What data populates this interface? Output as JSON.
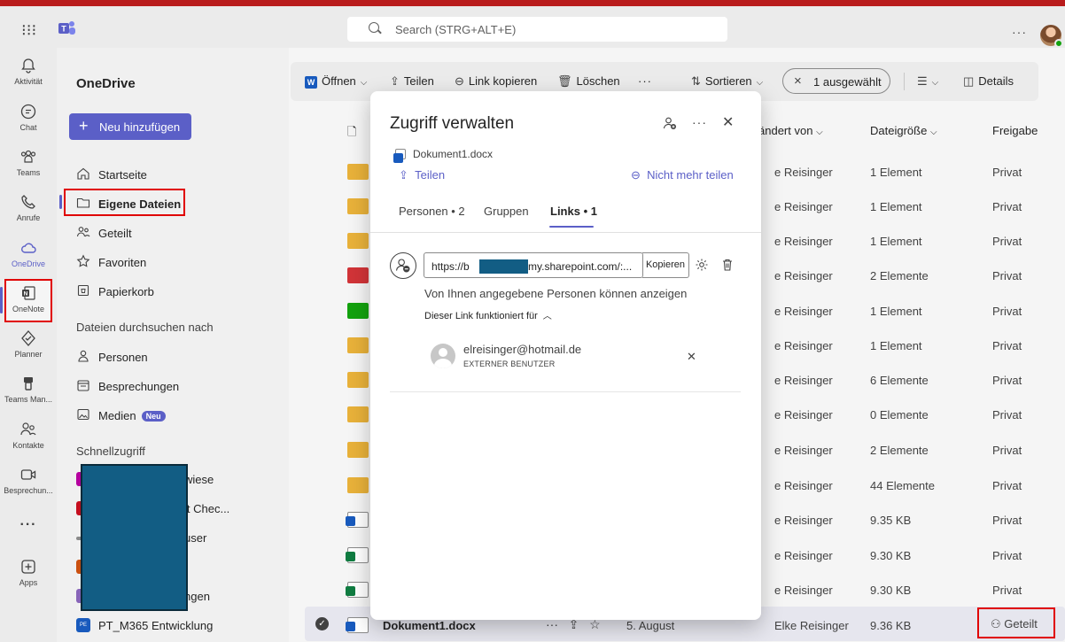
{
  "topbar": {
    "search_placeholder": "Search (STRG+ALT+E)",
    "more": "···"
  },
  "rail": {
    "items": [
      {
        "label": "Aktivität",
        "icon": "bell-icon"
      },
      {
        "label": "Chat",
        "icon": "chat-icon"
      },
      {
        "label": "Teams",
        "icon": "teams-icon"
      },
      {
        "label": "Anrufe",
        "icon": "phone-icon"
      },
      {
        "label": "OneDrive",
        "icon": "cloud-icon"
      },
      {
        "label": "OneNote",
        "icon": "onenote-icon"
      },
      {
        "label": "Planner",
        "icon": "planner-icon"
      },
      {
        "label": "Teams Man...",
        "icon": "teams-manager-icon"
      },
      {
        "label": "Kontakte",
        "icon": "contacts-icon"
      },
      {
        "label": "Besprechun...",
        "icon": "video-icon"
      },
      {
        "label": "···",
        "icon": "more-icon"
      },
      {
        "label": "Apps",
        "icon": "apps-icon"
      }
    ]
  },
  "sidebar": {
    "title": "OneDrive",
    "new_button": "Neu hinzufügen",
    "nav": [
      {
        "label": "Startseite"
      },
      {
        "label": "Eigene Dateien"
      },
      {
        "label": "Geteilt"
      },
      {
        "label": "Favoriten"
      },
      {
        "label": "Papierkorb"
      }
    ],
    "browse_header": "Dateien durchsuchen nach",
    "browse": [
      {
        "label": "Personen"
      },
      {
        "label": "Besprechungen"
      },
      {
        "label": "Medien",
        "badge": "Neu"
      }
    ],
    "quick_header": "Schnellzugriff",
    "quick": [
      {
        "label": "wiese",
        "color": "#b4009e"
      },
      {
        "label": "lt Chec...",
        "color": "#c50f1f"
      },
      {
        "label": "user",
        "color": "#8a8a8a"
      },
      {
        "label": "",
        "color": "#ca5010"
      },
      {
        "label": "ngen",
        "color": "#8764b8"
      },
      {
        "label": "PT_M365 Entwicklung",
        "color": "#185abd",
        "abbr": "PE"
      }
    ]
  },
  "toolbar": {
    "open": "Öffnen",
    "share": "Teilen",
    "copy_link": "Link kopieren",
    "delete": "Löschen",
    "more": "···",
    "sort": "Sortieren",
    "selected": "1 ausgewählt",
    "details": "Details"
  },
  "table": {
    "col_modified_by": "ändert von",
    "col_size": "Dateigröße",
    "col_share": "Freigabe",
    "rows": [
      {
        "type": "folder",
        "by": "e Reisinger",
        "size": "1 Element",
        "share": "Privat"
      },
      {
        "type": "folder",
        "by": "e Reisinger",
        "size": "1 Element",
        "share": "Privat"
      },
      {
        "type": "folder",
        "by": "e Reisinger",
        "size": "1 Element",
        "share": "Privat"
      },
      {
        "type": "folder-red",
        "by": "e Reisinger",
        "size": "2 Elemente",
        "share": "Privat"
      },
      {
        "type": "folder-green",
        "by": "e Reisinger",
        "size": "1 Element",
        "share": "Privat"
      },
      {
        "type": "folder",
        "by": "e Reisinger",
        "size": "1 Element",
        "share": "Privat"
      },
      {
        "type": "folder",
        "by": "e Reisinger",
        "size": "6 Elemente",
        "share": "Privat"
      },
      {
        "type": "folder",
        "by": "e Reisinger",
        "size": "0 Elemente",
        "share": "Privat"
      },
      {
        "type": "folder",
        "by": "e Reisinger",
        "size": "2 Elemente",
        "share": "Privat"
      },
      {
        "type": "folder",
        "by": "e Reisinger",
        "size": "44 Elemente",
        "share": "Privat"
      },
      {
        "type": "word",
        "by": "e Reisinger",
        "size": "9.35 KB",
        "share": "Privat"
      },
      {
        "type": "excel",
        "by": "e Reisinger",
        "size": "9.30 KB",
        "share": "Privat"
      },
      {
        "type": "excel",
        "by": "e Reisinger",
        "size": "9.30 KB",
        "share": "Privat"
      }
    ],
    "selected_row": {
      "name": "Dokument1.docx",
      "modified": "5. August",
      "by": "Elke Reisinger",
      "size": "9.36 KB",
      "share": "Geteilt"
    }
  },
  "modal": {
    "title": "Zugriff verwalten",
    "file": "Dokument1.docx",
    "share": "Teilen",
    "stop_sharing": "Nicht mehr teilen",
    "tabs": [
      "Personen • 2",
      "Gruppen",
      "Links • 1"
    ],
    "url_start": "https://b",
    "url_end": "my.sharepoint.com/:...",
    "copy": "Kopieren",
    "scope": "Von Ihnen angegebene Personen können anzeigen",
    "works_for": "Dieser Link funktioniert für",
    "user_email": "elreisinger@hotmail.de",
    "user_type": "EXTERNER BENUTZER"
  }
}
